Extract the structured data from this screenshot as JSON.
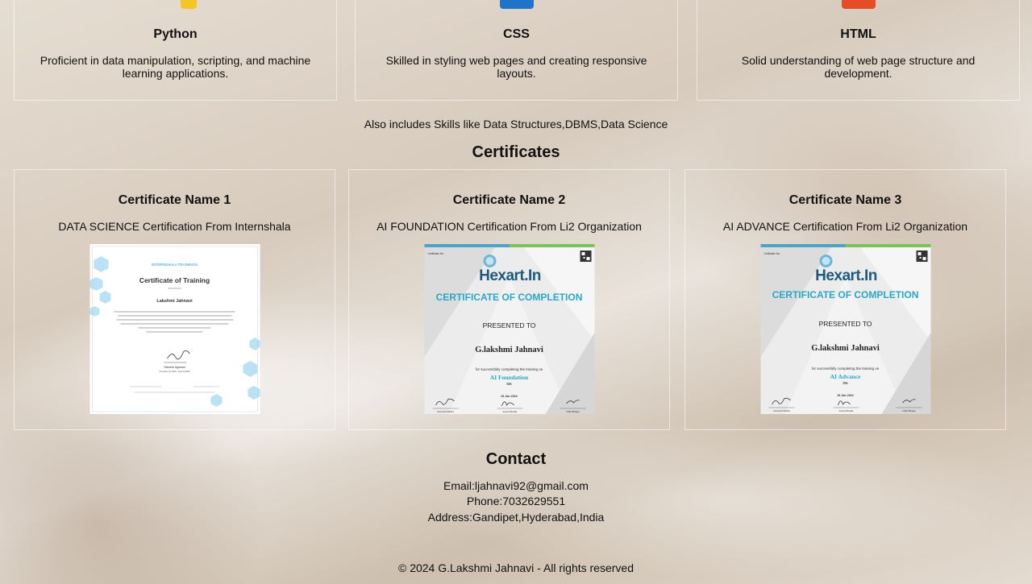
{
  "skills": [
    {
      "icon": "python-icon",
      "color": "#f3c623",
      "title": "Python",
      "desc": "Proficient in data manipulation, scripting, and machine learning applications."
    },
    {
      "icon": "css-icon",
      "color": "#1f73c8",
      "title": "CSS",
      "desc": "Skilled in styling web pages and creating responsive layouts."
    },
    {
      "icon": "html-icon",
      "color": "#e44d26",
      "title": "HTML",
      "desc": "Solid understanding of web page structure and development."
    }
  ],
  "also_includes": "Also includes Skills like Data Structures,DBMS,Data Science",
  "certificates": {
    "heading": "Certificates",
    "items": [
      {
        "name": "Certificate Name 1",
        "desc": "DATA SCIENCE Certification From Internshala",
        "image": {
          "header": "INTERNSHALA TRAININGS",
          "title": "Certificate of Training",
          "recipient": "Lakshmi Jahnavi",
          "signatory": "Sarvesh Agrawal",
          "signatory_role": "Founder & CEO, Internshala"
        }
      },
      {
        "name": "Certificate Name 2",
        "desc": "AI FOUNDATION Certification From Li2 Organization",
        "image": {
          "brand": "Hexart.In",
          "title": "CERTIFICATE OF COMPLETION",
          "presented": "PRESENTED TO",
          "recipient": "G.lakshmi Jahnavi",
          "training": "for successfully completing the training on",
          "course": "AI Foundation",
          "on": "On",
          "date": "26 Jan 2024",
          "signers": [
            "Hemanth Mishra",
            "Govind Reddy",
            "Nidhi Bhagat"
          ]
        }
      },
      {
        "name": "Certificate Name 3",
        "desc": "AI ADVANCE Certification From Li2 Organization",
        "image": {
          "brand": "Hexart.In",
          "title": "CERTIFICATE OF COMPLETION",
          "presented": "PRESENTED TO",
          "recipient": "G.lakshmi Jahnavi",
          "training": "for successfully completing the training on",
          "course": "AI Advance",
          "on": "On",
          "date": "26 Jan 2024",
          "signers": [
            "Hemanth Mishra",
            "Govind Reddy",
            "Nidhi Bhagat"
          ]
        }
      }
    ]
  },
  "contact": {
    "heading": "Contact",
    "email": "Email:ljahnavi92@gmail.com",
    "phone": "Phone:7032629551",
    "address": "Address:Gandipet,Hyderabad,India"
  },
  "footer": "© 2024 G.Lakshmi Jahnavi - All rights reserved"
}
